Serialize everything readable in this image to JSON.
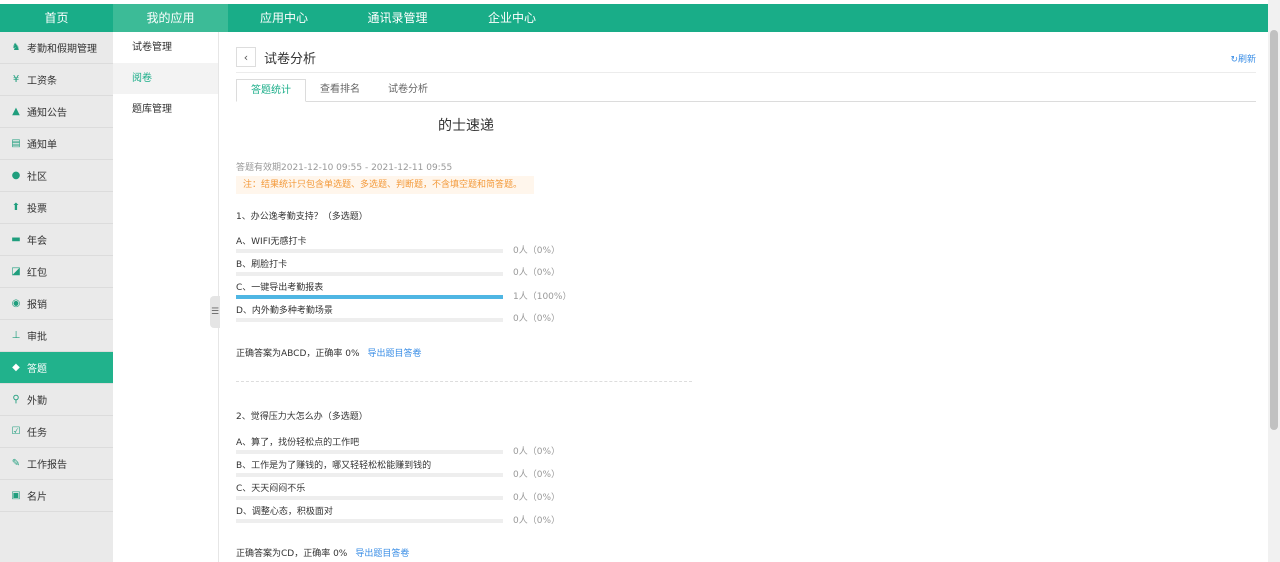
{
  "topnav": [
    {
      "label": "首页",
      "active": false
    },
    {
      "label": "我的应用",
      "active": true
    },
    {
      "label": "应用中心",
      "active": false
    },
    {
      "label": "通讯录管理",
      "active": false
    },
    {
      "label": "企业中心",
      "active": false
    }
  ],
  "sidebar": [
    {
      "label": "考勤和假期管理",
      "icon": "attendance-icon",
      "active": false
    },
    {
      "label": "工资条",
      "icon": "salary-icon",
      "active": false
    },
    {
      "label": "通知公告",
      "icon": "bell-icon",
      "active": false
    },
    {
      "label": "通知单",
      "icon": "notice-icon",
      "active": false
    },
    {
      "label": "社区",
      "icon": "chat-icon",
      "active": false
    },
    {
      "label": "投票",
      "icon": "vote-icon",
      "active": false
    },
    {
      "label": "年会",
      "icon": "party-icon",
      "active": false
    },
    {
      "label": "红包",
      "icon": "redpacket-icon",
      "active": false
    },
    {
      "label": "报销",
      "icon": "reimburse-icon",
      "active": false
    },
    {
      "label": "审批",
      "icon": "approval-icon",
      "active": false
    },
    {
      "label": "答题",
      "icon": "quiz-icon",
      "active": true
    },
    {
      "label": "外勤",
      "icon": "location-icon",
      "active": false
    },
    {
      "label": "任务",
      "icon": "task-icon",
      "active": false
    },
    {
      "label": "工作报告",
      "icon": "report-icon",
      "active": false
    },
    {
      "label": "名片",
      "icon": "card-icon",
      "active": false
    }
  ],
  "subnav": [
    {
      "label": "试卷管理",
      "active": false
    },
    {
      "label": "阅卷",
      "active": true
    },
    {
      "label": "题库管理",
      "active": false
    }
  ],
  "page": {
    "title": "试卷分析",
    "refresh": "刷新",
    "tabs": [
      {
        "label": "答题统计",
        "active": true
      },
      {
        "label": "查看排名",
        "active": false
      },
      {
        "label": "试卷分析",
        "active": false
      }
    ],
    "exam_title": "的士速递",
    "validity": "答题有效期2021-12-10 09:55 - 2021-12-11 09:55",
    "note": "注：结果统计只包含单选题、多选题、判断题，不含填空题和简答题。"
  },
  "questions": [
    {
      "title": "1、办公逸考勤支持？（多选题）",
      "options": [
        {
          "label": "A、WIFI无感打卡",
          "count": "0人（0%）",
          "ratio": 0
        },
        {
          "label": "B、刷脸打卡",
          "count": "0人（0%）",
          "ratio": 0
        },
        {
          "label": "C、一键导出考勤报表",
          "count": "1人（100%）",
          "ratio": 1
        },
        {
          "label": "D、内外勤多种考勤场景",
          "count": "0人（0%）",
          "ratio": 0
        }
      ],
      "answer": "正确答案为ABCD，正确率 0%",
      "export": "导出题目答卷"
    },
    {
      "title": "2、觉得压力大怎么办（多选题）",
      "options": [
        {
          "label": "A、算了，找份轻松点的工作吧",
          "count": "0人（0%）",
          "ratio": 0
        },
        {
          "label": "B、工作是为了赚钱的，哪又轻轻松松能赚到钱的",
          "count": "0人（0%）",
          "ratio": 0
        },
        {
          "label": "C、天天闷闷不乐",
          "count": "0人（0%）",
          "ratio": 0
        },
        {
          "label": "D、调整心态，积极面对",
          "count": "0人（0%）",
          "ratio": 0
        }
      ],
      "answer": "正确答案为CD，正确率 0%",
      "export": "导出题目答卷"
    }
  ]
}
